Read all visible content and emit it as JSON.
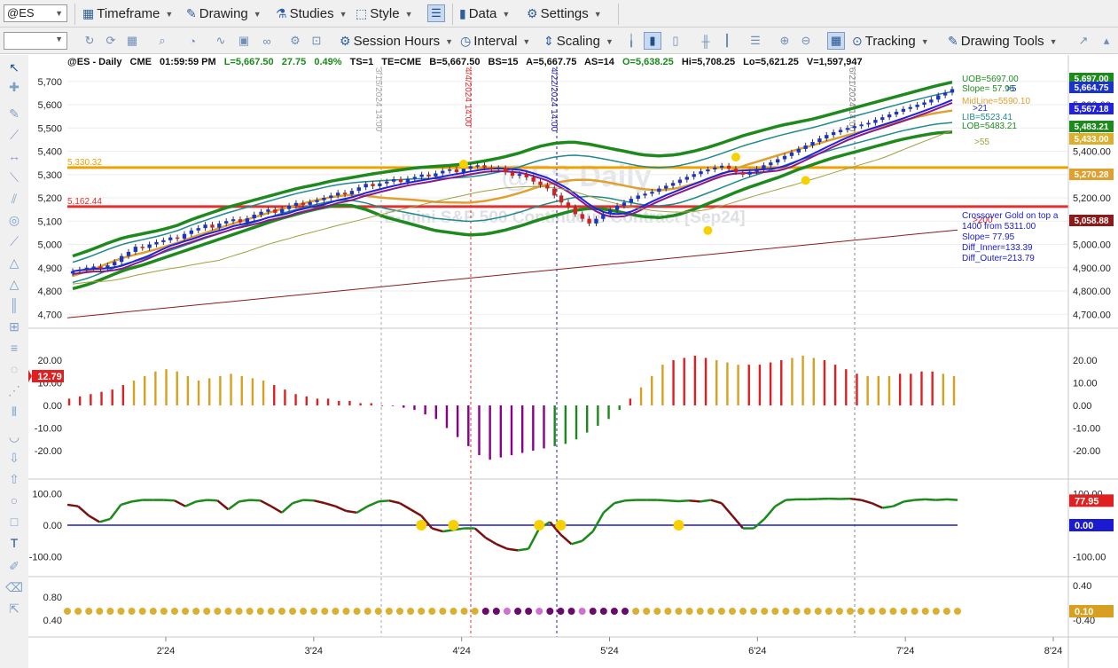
{
  "toolbar1": {
    "symbol": "@ES",
    "timeframe": "Timeframe",
    "drawing": "Drawing",
    "studies": "Studies",
    "style": "Style",
    "data": "Data",
    "settings": "Settings"
  },
  "toolbar2": {
    "session_hours": "Session Hours",
    "interval": "Interval",
    "scaling": "Scaling",
    "tracking": "Tracking",
    "drawing_tools": "Drawing Tools"
  },
  "icons": {
    "timeframe": "calendar-clock-icon",
    "drawing": "pen-icon",
    "studies": "flask-icon",
    "style": "style-icon",
    "data": "data-bars-icon",
    "settings": "gear-icon",
    "session_hours": "session-hours-icon",
    "interval": "clock-icon",
    "scaling": "scaling-icon",
    "tracking": "tracking-crosshair-icon",
    "drawing_tools": "drawing-tools-icon"
  },
  "colors": {
    "up_bar": "#1a34c8",
    "down_bar": "#d42020",
    "band_outer": "#1e8a1e",
    "band_inner": "#1f8a8a",
    "midline": "#e0a030",
    "ma_blue": "#2222dd",
    "ma_purple": "#8a1a8a",
    "ma_olive": "#a0a040",
    "ma_long": "#8b1a1a",
    "hline_orange": "#f0a000",
    "hline_red": "#e03030",
    "dot_gold": "#dbb030",
    "dot_purple": "#6a0a6a",
    "dot_pink": "#d070d0",
    "hist_gold": "#d8a020",
    "hist_red": "#e02020",
    "hist_purple": "#8a008a",
    "hist_green": "#1a8a1a",
    "slope_line": "#1a8a1a",
    "slope_dark": "#7a1010"
  },
  "chart_data": {
    "type": "candlestick",
    "header": {
      "symbol": "@ES - Daily",
      "exchange": "CME",
      "time": "01:59:59 PM",
      "last": "L=5,667.50",
      "change": "27.75",
      "change_pct": "0.49%",
      "ts": "TS=1",
      "te": "TE=CME",
      "bid": "B=5,667.50",
      "bid_size": "BS=15",
      "ask": "A=5,667.75",
      "ask_size": "AS=14",
      "open": "O=5,638.25",
      "high": "Hi=5,708.25",
      "low": "Lo=5,621.25",
      "volume": "V=1,597,947"
    },
    "watermark": {
      "line1": "@ES Daily",
      "line2": "E-mini S&P 500 Continuous Contract [Sep24]"
    },
    "price_axis": {
      "ticks": [
        "5,700.00",
        "5,600.00",
        "5,500.00",
        "5,400.00",
        "5,300.00",
        "5,200.00",
        "5,100.00",
        "5,000.00",
        "4,900.00",
        "4,800.00",
        "4,700.00"
      ],
      "ylim": [
        4640,
        5745
      ]
    },
    "x_axis": {
      "labels": [
        "2'24",
        "3'24",
        "4'24",
        "5'24",
        "6'24",
        "7'24",
        "8'24"
      ]
    },
    "close_series": [
      4885,
      4892,
      4900,
      4905,
      4895,
      4910,
      4925,
      4950,
      4968,
      4990,
      4985,
      5000,
      5010,
      5018,
      5030,
      5025,
      5045,
      5060,
      5070,
      5085,
      5072,
      5090,
      5100,
      5108,
      5095,
      5112,
      5128,
      5140,
      5150,
      5136,
      5152,
      5166,
      5178,
      5170,
      5182,
      5190,
      5200,
      5210,
      5222,
      5215,
      5230,
      5245,
      5260,
      5250,
      5262,
      5270,
      5280,
      5268,
      5282,
      5290,
      5300,
      5292,
      5305,
      5316,
      5322,
      5310,
      5325,
      5336,
      5340,
      5330,
      5322,
      5328,
      5310,
      5295,
      5302,
      5288,
      5270,
      5255,
      5240,
      5210,
      5180,
      5160,
      5130,
      5110,
      5090,
      5110,
      5130,
      5148,
      5166,
      5180,
      5196,
      5210,
      5218,
      5226,
      5240,
      5252,
      5264,
      5278,
      5290,
      5302,
      5314,
      5322,
      5330,
      5338,
      5325,
      5310,
      5300,
      5312,
      5325,
      5340,
      5352,
      5366,
      5380,
      5395,
      5410,
      5425,
      5440,
      5455,
      5470,
      5482,
      5492,
      5500,
      5508,
      5515,
      5522,
      5535,
      5546,
      5558,
      5570,
      5582,
      5590,
      5600,
      5610,
      5622,
      5640,
      5652,
      5667
    ],
    "overlays": {
      "uob": [
        4950,
        4975,
        5005,
        5030,
        5045,
        5060,
        5080,
        5110,
        5135,
        5160,
        5180,
        5200,
        5220,
        5240,
        5255,
        5272,
        5285,
        5298,
        5310,
        5320,
        5330,
        5335,
        5340,
        5348,
        5360,
        5375,
        5395,
        5420,
        5435,
        5440,
        5430,
        5415,
        5400,
        5385,
        5380,
        5385,
        5400,
        5420,
        5445,
        5470,
        5490,
        5510,
        5525,
        5540,
        5560,
        5580,
        5600,
        5620,
        5640,
        5660,
        5680,
        5697
      ],
      "lob": [
        4810,
        4830,
        4860,
        4890,
        4910,
        4935,
        4960,
        4985,
        5010,
        5035,
        5060,
        5085,
        5110,
        5130,
        5150,
        5165,
        5170,
        5150,
        5120,
        5100,
        5080,
        5060,
        5050,
        5040,
        5045,
        5060,
        5080,
        5105,
        5125,
        5145,
        5155,
        5150,
        5135,
        5120,
        5115,
        5125,
        5150,
        5180,
        5210,
        5240,
        5265,
        5290,
        5320,
        5345,
        5370,
        5390,
        5410,
        5430,
        5450,
        5465,
        5478,
        5483
      ]
    },
    "levels": [
      {
        "label": "5,330.32",
        "value": 5330.32
      },
      {
        "label": "5,162.44",
        "value": 5162.44
      }
    ],
    "vertical_markers": [
      "3/15/2024 14:00",
      "4/4/2024 14:00",
      "4/22/2024 14:00",
      "6/21/2024 14:00"
    ],
    "right_labels": [
      {
        "text": "UOB=5697.00",
        "color": "#1e8a1e"
      },
      {
        "text": "Slope= 57.95",
        "color": "#1e8a1e"
      },
      {
        "text": ">5"
      },
      {
        "text": "MidLine=5590.10",
        "color": "#e0a030"
      },
      {
        "text": ">21",
        "color": "#1a34c8"
      },
      {
        "text": "LIB=5523.41",
        "color": "#1f8a8a"
      },
      {
        "text": "LOB=5483.21",
        "color": "#1e8a1e"
      },
      {
        "text": ">55",
        "color": "#a0a040"
      },
      {
        "text": ">200",
        "color": "#d42020"
      }
    ],
    "info_text": [
      "Crossover Gold on top a",
      "1400 from 5311.00",
      "Slope= 77.95",
      "Diff_Inner=133.39",
      "Diff_Outer=213.79"
    ],
    "price_badges": [
      {
        "text": "5,697.00",
        "color": "#1e8a1e"
      },
      {
        "text": "5,664.75",
        "color": "#1a34c8"
      },
      {
        "text": "5,567.18",
        "color": "#2222dd"
      },
      {
        "text": "5,483.21",
        "color": "#1e8a1e"
      },
      {
        "text": "5,433.00",
        "color": "#dbb030"
      },
      {
        "text": "5,270.28",
        "color": "#e0a030"
      },
      {
        "text": "5,058.88",
        "color": "#8b1a1a"
      }
    ],
    "histogram": {
      "ticks": [
        "20.00",
        "10.00",
        "0.00",
        "-10.00",
        "-20.00"
      ],
      "ylim": [
        -26,
        27
      ],
      "badge": "12.79",
      "values": [
        3,
        4,
        5,
        6,
        7,
        9,
        11,
        13,
        15,
        16,
        15,
        13,
        11,
        12,
        13,
        14,
        13,
        12,
        11,
        9,
        7,
        5,
        4,
        3,
        3,
        2,
        2,
        1,
        1,
        0,
        0,
        -1,
        -2,
        -4,
        -6,
        -10,
        -14,
        -18,
        -22,
        -24,
        -23,
        -22,
        -21,
        -20,
        -19,
        -18,
        -17,
        -15,
        -12,
        -9,
        -6,
        -2,
        3,
        8,
        13,
        18,
        20,
        21,
        22,
        21,
        20,
        19,
        18,
        18,
        18,
        19,
        20,
        21,
        22,
        21,
        20,
        18,
        16,
        14,
        13,
        13,
        13,
        14,
        14,
        15,
        15,
        14,
        13
      ]
    },
    "slope_panel": {
      "ticks": [
        "100.00",
        "0.00",
        "-100.00"
      ],
      "ylim": [
        -150,
        150
      ],
      "badge_slope": "77.95",
      "badge_zero": "0.00",
      "values": [
        65,
        60,
        30,
        10,
        20,
        65,
        75,
        80,
        80,
        80,
        78,
        60,
        75,
        80,
        78,
        50,
        75,
        80,
        78,
        60,
        40,
        70,
        80,
        78,
        70,
        60,
        45,
        40,
        60,
        75,
        78,
        70,
        50,
        30,
        -10,
        -20,
        -15,
        -10,
        -10,
        -40,
        -60,
        -75,
        -80,
        -75,
        -10,
        10,
        -30,
        -60,
        -50,
        -20,
        40,
        70,
        78,
        80,
        80,
        80,
        78,
        76,
        78,
        75,
        80,
        70,
        30,
        -10,
        -10,
        20,
        60,
        80,
        82,
        82,
        83,
        84,
        83,
        84,
        80,
        70,
        55,
        60,
        75,
        80,
        82,
        80,
        82,
        80
      ]
    },
    "dots_panel": {
      "ticks": [
        "0.80",
        "0.40",
        "-0.40"
      ],
      "badge": "0.10"
    }
  }
}
